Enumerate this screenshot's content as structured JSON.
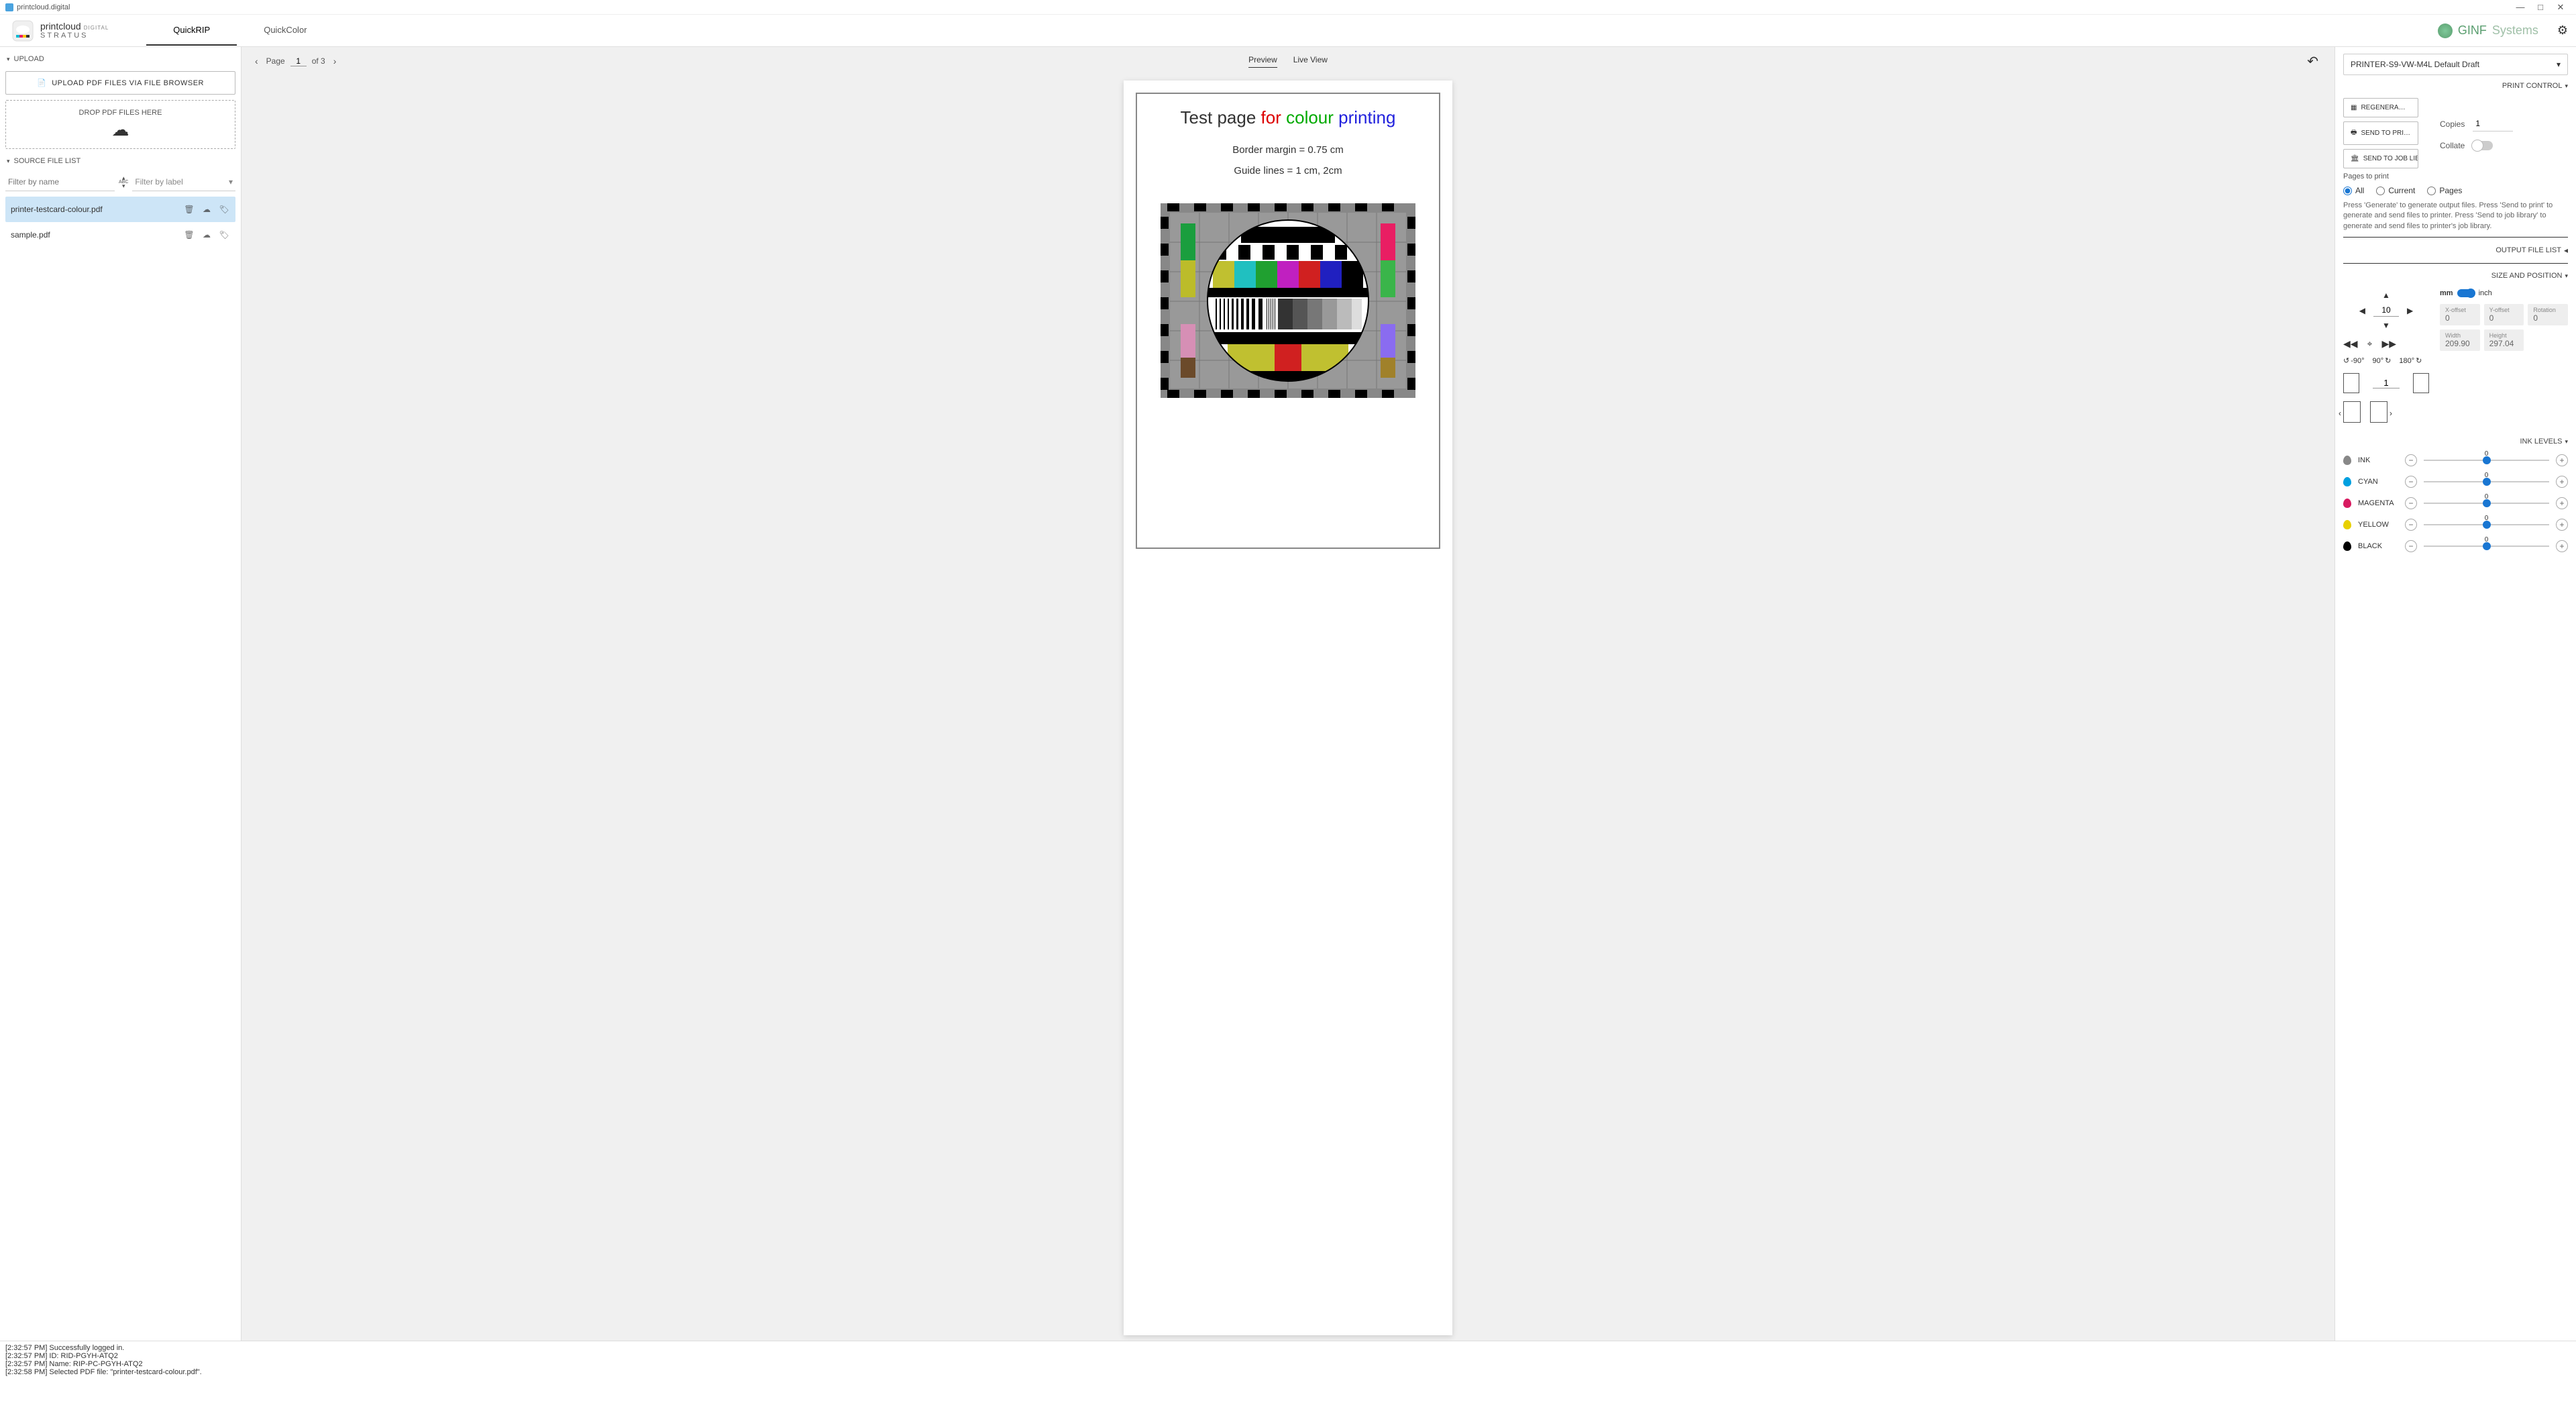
{
  "window": {
    "title": "printcloud.digital"
  },
  "brand": {
    "main": "printcloud",
    "suffix": "DIGITAL",
    "sub": "STRATUS"
  },
  "tabs": {
    "rip": "QuickRIP",
    "color": "QuickColor"
  },
  "company": {
    "a": "GINF",
    "b": "Systems"
  },
  "upload": {
    "hdr": "UPLOAD",
    "btn": "UPLOAD PDF FILES VIA FILE BROWSER",
    "drop": "DROP PDF FILES HERE"
  },
  "srclist": {
    "hdr": "SOURCE FILE LIST",
    "filterName": "Filter by name",
    "filterLabel": "Filter by label"
  },
  "files": [
    {
      "name": "printer-testcard-colour.pdf",
      "sel": true
    },
    {
      "name": "sample.pdf",
      "sel": false
    }
  ],
  "pager": {
    "label": "Page",
    "cur": "1",
    "of": "of 3"
  },
  "viewtabs": {
    "preview": "Preview",
    "live": "Live View"
  },
  "page": {
    "t1": "Test page ",
    "t2": "for ",
    "t3": "colour ",
    "t4": "printing",
    "l1": "Border margin = 0.75 cm",
    "l2": "Guide lines = 1 cm, 2cm"
  },
  "printer": "PRINTER-S9-VW-M4L Default Draft",
  "printctl": {
    "hdr": "PRINT CONTROL",
    "regen": "REGENERA…",
    "send": "SEND TO PRI…",
    "joblib": "SEND TO JOB LIBRAR…",
    "copies": "Copies",
    "copiesVal": "1",
    "collate": "Collate",
    "pagesHdr": "Pages to print",
    "all": "All",
    "current": "Current",
    "pages": "Pages",
    "help": "Press 'Generate' to generate output files. Press 'Send to print' to generate and send files to printer. Press 'Send to job library' to generate and send files to printer's job library."
  },
  "outlist": {
    "hdr": "OUTPUT FILE LIST"
  },
  "sizepos": {
    "hdr": "SIZE AND POSITION",
    "nudge": "10",
    "mm": "mm",
    "inch": "inch",
    "xoff": {
      "lbl": "X-offset",
      "val": "0"
    },
    "yoff": {
      "lbl": "Y-offset",
      "val": "0"
    },
    "rot": {
      "lbl": "Rotation",
      "val": "0"
    },
    "w": {
      "lbl": "Width",
      "val": "209.90"
    },
    "h": {
      "lbl": "Height",
      "val": "297.04"
    },
    "r90n": "-90°",
    "r90": "90°",
    "r180": "180°",
    "mirrorVal": "1"
  },
  "ink": {
    "hdr": "INK LEVELS",
    "rows": [
      {
        "name": "INK",
        "color": "#888",
        "val": "0"
      },
      {
        "name": "CYAN",
        "color": "#00a0e0",
        "val": "0"
      },
      {
        "name": "MAGENTA",
        "color": "#d81b60",
        "val": "0"
      },
      {
        "name": "YELLOW",
        "color": "#e8d000",
        "val": "0"
      },
      {
        "name": "BLACK",
        "color": "#000",
        "val": "0"
      }
    ]
  },
  "log": [
    "[2:32:57 PM] Successfully logged in.",
    "[2:32:57 PM] ID: RID-PGYH-ATQ2",
    "[2:32:57 PM] Name: RIP-PC-PGYH-ATQ2",
    "[2:32:58 PM] Selected PDF file: \"printer-testcard-colour.pdf\"."
  ]
}
